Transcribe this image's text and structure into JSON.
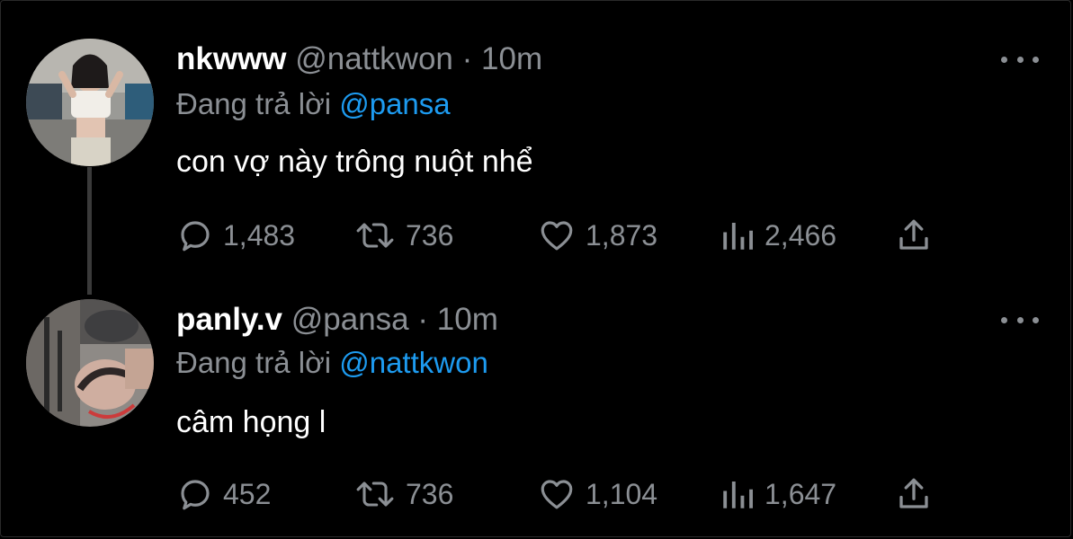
{
  "colors": {
    "background": "#000000",
    "name": "#ffffff",
    "secondary_text": "#8b8f94",
    "mention": "#1d9bf0",
    "thread_line": "#3a3a3a"
  },
  "tweets": [
    {
      "name": "nkwww",
      "handle": "@nattkwon",
      "separator": "·",
      "time": "10m",
      "replying_label": "Đang trả lời",
      "replying_to": "@pansa",
      "text": "con vợ này trông nuột nhể",
      "replies": "1,483",
      "retweets": "736",
      "likes": "1,873",
      "views": "2,466",
      "icons": [
        "reply-icon",
        "retweet-icon",
        "like-icon",
        "views-icon",
        "share-icon",
        "more-icon"
      ]
    },
    {
      "name": "panly.v",
      "handle": "@pansa",
      "separator": "·",
      "time": "10m",
      "replying_label": "Đang trả lời",
      "replying_to": "@nattkwon",
      "text": "câm họng l",
      "replies": "452",
      "retweets": "736",
      "likes": "1,104",
      "views": "1,647",
      "icons": [
        "reply-icon",
        "retweet-icon",
        "like-icon",
        "views-icon",
        "share-icon",
        "more-icon"
      ]
    }
  ]
}
